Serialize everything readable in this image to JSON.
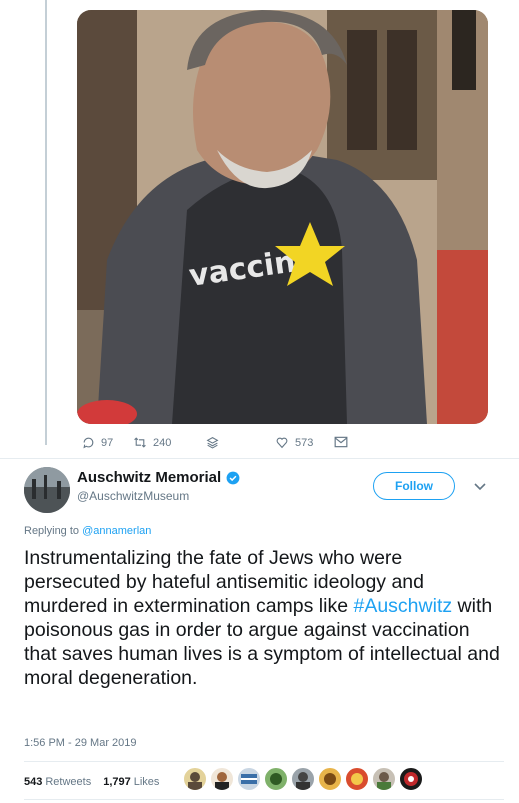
{
  "media": {
    "shirt_text": "vaccina",
    "colors": {
      "star": "#f2d524",
      "jacket": "#4b4c52",
      "shirt": "#2e2f33",
      "wall": "#b9a48c"
    }
  },
  "actions": {
    "replies": "97",
    "retweets": "240",
    "likes": "573"
  },
  "author": {
    "name": "Auschwitz Memorial",
    "handle": "@AuschwitzMuseum",
    "follow_label": "Follow"
  },
  "tweet": {
    "replying_prefix": "Replying to",
    "replying_handle": "@annamerlan",
    "text_part1": "Instrumentalizing the fate of Jews who were persecuted by hateful antisemitic ideology and murdered in extermination camps like ",
    "hashtag": "#Auschwitz",
    "text_part2": " with poisonous gas in order to argue against vaccination that saves human lives is a symptom of intellectual and moral degeneration.",
    "timestamp": "1:56 PM - 29 Mar 2019"
  },
  "stats": {
    "retweets_count": "543",
    "retweets_label": "Retweets",
    "likes_count": "1,797",
    "likes_label": "Likes"
  },
  "theme": {
    "accent": "#1da1f2",
    "muted": "#657786",
    "text": "#14171a",
    "border": "#e6ecf0"
  }
}
